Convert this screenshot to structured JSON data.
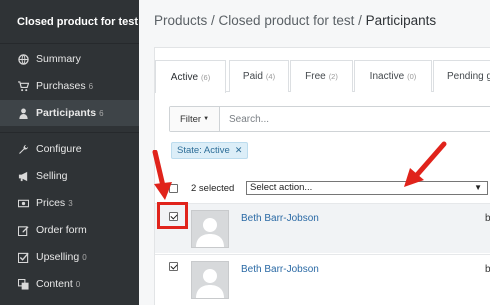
{
  "sidebar": {
    "title": "Closed product for test",
    "items": [
      {
        "label": "Summary",
        "count": "",
        "icon": "globe-icon"
      },
      {
        "label": "Purchases",
        "count": "6",
        "icon": "cart-icon"
      },
      {
        "label": "Participants",
        "count": "6",
        "icon": "user-icon",
        "active": true
      },
      {
        "label": "Configure",
        "count": "",
        "icon": "wrench-icon"
      },
      {
        "label": "Selling",
        "count": "",
        "icon": "megaphone-icon"
      },
      {
        "label": "Prices",
        "count": "3",
        "icon": "money-icon"
      },
      {
        "label": "Order form",
        "count": "",
        "icon": "edit-icon"
      },
      {
        "label": "Upselling",
        "count": "0",
        "icon": "check-square-icon"
      },
      {
        "label": "Content",
        "count": "0",
        "icon": "layers-icon"
      }
    ]
  },
  "breadcrumb": {
    "part1": "Products",
    "sep1": " / ",
    "part2": "Closed product for test",
    "sep2": " / ",
    "current": "Participants"
  },
  "tabs": [
    {
      "label": "Active",
      "count": "(6)"
    },
    {
      "label": "Paid",
      "count": "(4)"
    },
    {
      "label": "Free",
      "count": "(2)"
    },
    {
      "label": "Inactive",
      "count": "(0)"
    },
    {
      "label": "Pending g",
      "count": ""
    }
  ],
  "filter": {
    "button_label": "Filter",
    "search_placeholder": "Search..."
  },
  "chip": {
    "label": "State: Active",
    "close": "✕"
  },
  "bulk": {
    "selected_text": "2 selected",
    "select_value": "Select action..."
  },
  "rows": [
    {
      "name": "Beth Barr-Jobson",
      "extra": "b",
      "checked": true
    },
    {
      "name": "Beth Barr-Jobson",
      "extra": "b",
      "checked": true
    }
  ],
  "colors": {
    "annotation": "#e0231b",
    "sidebar_bg": "#2f3336",
    "link": "#2b6aa5"
  }
}
